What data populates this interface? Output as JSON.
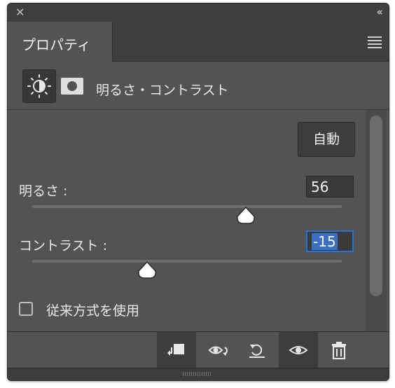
{
  "panel": {
    "tab_label": "プロパティ",
    "header_title": "明るさ・コントラスト"
  },
  "controls": {
    "auto_button": "自動",
    "brightness": {
      "label": "明るさ :",
      "value": "56",
      "slider_fraction": 0.689
    },
    "contrast": {
      "label": "コントラスト :",
      "value": "-15",
      "slider_fraction": 0.37
    },
    "legacy_checkbox": {
      "label": "従来方式を使用",
      "checked": false
    }
  },
  "icons": {
    "close": "close-icon",
    "collapse": "collapse-icon",
    "menu": "panel-menu-icon",
    "adjustment": "brightness-contrast-icon",
    "mask": "layer-mask-icon",
    "bottom": [
      "clip-to-layer-icon",
      "view-previous-state-icon",
      "reset-icon",
      "visibility-eye-icon",
      "trash-icon"
    ]
  },
  "colors": {
    "panel_bg": "#535353",
    "dark_bg": "#3f3f3f",
    "focus_blue": "#2a6fd6",
    "selection_blue": "#3d6fc4"
  }
}
